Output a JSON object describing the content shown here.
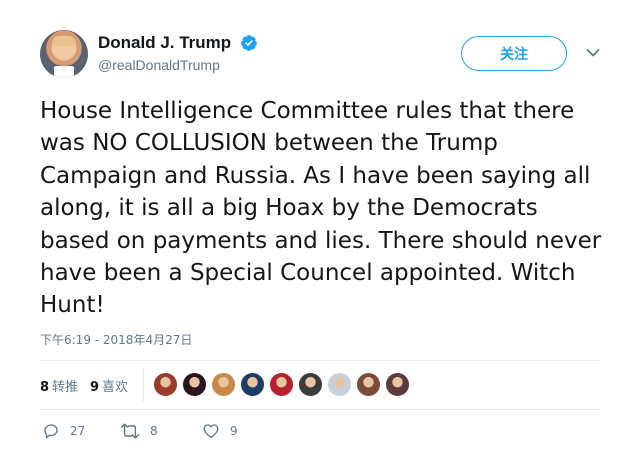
{
  "author": {
    "display_name": "Donald J. Trump",
    "handle": "@realDonaldTrump",
    "verified_color": "#1da1f2"
  },
  "follow_button": {
    "label": "关注"
  },
  "tweet": {
    "text": "House Intelligence Committee rules that there was NO COLLUSION between the Trump Campaign and Russia. As I have been saying all along, it is all a big Hoax by the Democrats based on payments and lies. There should never have been a Special Councel appointed. Witch Hunt!",
    "timestamp": "下午6:19 - 2018年4月27日"
  },
  "stats": {
    "retweets_count": "8",
    "retweets_label": "转推",
    "likes_count": "9",
    "likes_label": "喜欢",
    "liker_avatar_colors": [
      "#9b3b2e",
      "#2a1620",
      "#c78a4a",
      "#1f3c66",
      "#b8202e",
      "#3c3c3c",
      "#c7d1dc",
      "#7a4a3a",
      "#5a3c3c"
    ]
  },
  "actions": {
    "reply_count": "27",
    "retweet_count": "8",
    "like_count": "9"
  },
  "colors": {
    "accent": "#1da1f2",
    "secondary_text": "#657786",
    "primary_text": "#14171a"
  }
}
